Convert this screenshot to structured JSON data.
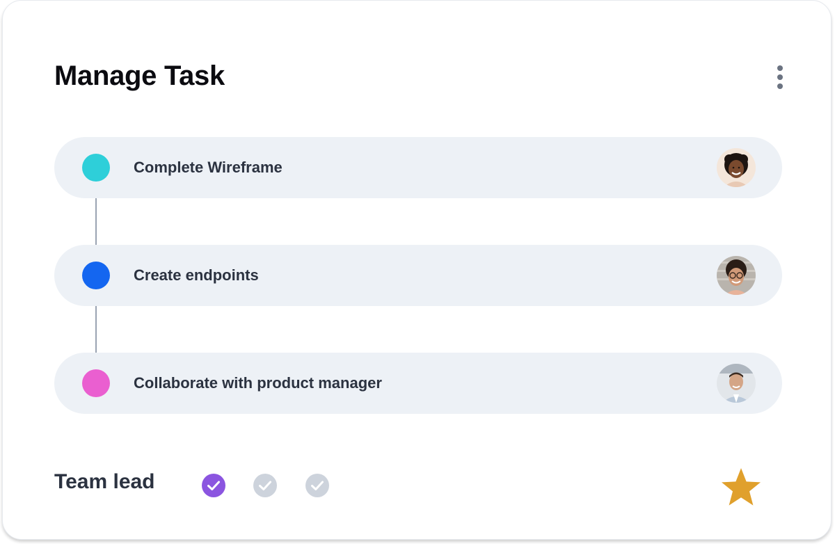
{
  "card": {
    "title": "Manage Task",
    "menu_icon": "more-vertical-icon"
  },
  "tasks": [
    {
      "label": "Complete Wireframe",
      "status_color": "#2ecfd9",
      "avatar": "avatar-woman-curly-hair"
    },
    {
      "label": "Create endpoints",
      "status_color": "#1466f0",
      "avatar": "avatar-woman-glasses"
    },
    {
      "label": "Collaborate with product manager",
      "status_color": "#ea5fd0",
      "avatar": "avatar-man-smiling"
    }
  ],
  "footer": {
    "label": "Team lead",
    "checks": [
      {
        "icon": "check-circle-icon",
        "active": true,
        "color": "#8b55e0"
      },
      {
        "icon": "check-circle-icon",
        "active": false,
        "color": "#cdd3dc"
      },
      {
        "icon": "check-circle-icon",
        "active": false,
        "color": "#cdd3dc"
      }
    ],
    "star": {
      "icon": "star-icon",
      "color": "#e0a02c"
    }
  }
}
